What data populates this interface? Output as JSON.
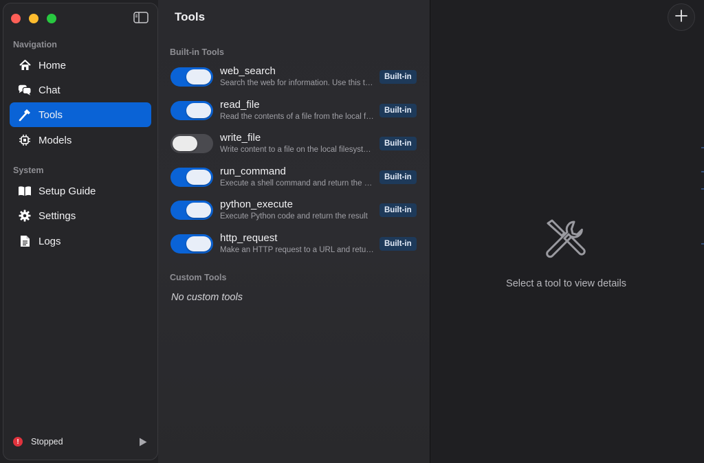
{
  "sidebar": {
    "sections": [
      {
        "title": "Navigation"
      },
      {
        "title": "System"
      }
    ],
    "items": [
      {
        "label": "Home",
        "icon": "house-icon"
      },
      {
        "label": "Chat",
        "icon": "chat-bubbles-icon"
      },
      {
        "label": "Tools",
        "icon": "hammer-icon",
        "active": true
      },
      {
        "label": "Models",
        "icon": "cpu-chip-icon"
      },
      {
        "label": "Setup Guide",
        "icon": "book-icon"
      },
      {
        "label": "Settings",
        "icon": "gear-icon"
      },
      {
        "label": "Logs",
        "icon": "document-icon"
      }
    ],
    "status": {
      "badge": "!",
      "label": "Stopped",
      "color": "#e0333d"
    }
  },
  "tools": {
    "title": "Tools",
    "builtin_title": "Built-in Tools",
    "custom_title": "Custom Tools",
    "custom_empty": "No custom tools",
    "badge_label": "Built-in",
    "list": [
      {
        "name": "web_search",
        "description": "Search the web for information. Use this tool to find current information",
        "enabled": true
      },
      {
        "name": "read_file",
        "description": "Read the contents of a file from the local filesystem",
        "enabled": true
      },
      {
        "name": "write_file",
        "description": "Write content to a file on the local filesystem",
        "enabled": false
      },
      {
        "name": "run_command",
        "description": "Execute a shell command and return the output",
        "enabled": true
      },
      {
        "name": "python_execute",
        "description": "Execute Python code and return the result",
        "enabled": true
      },
      {
        "name": "http_request",
        "description": "Make an HTTP request to a URL and return the response",
        "enabled": true
      }
    ]
  },
  "detail": {
    "placeholder": "Select a tool to view details",
    "placeholder_icon": "tools-crossed-icon",
    "add_icon": "plus-icon"
  },
  "colors": {
    "accent": "#0a63d6",
    "badge_bg": "#1e3a5a"
  }
}
